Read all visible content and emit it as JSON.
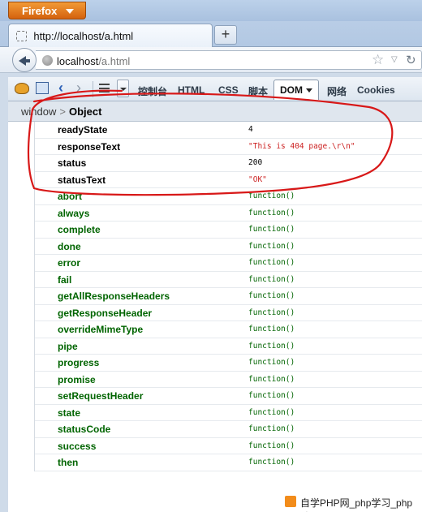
{
  "browser": {
    "firefox_menu_label": "Firefox",
    "ghost_tab_text": "...",
    "tab_title": "http://localhost/a.html",
    "new_tab_label": "+",
    "url_host": "localhost",
    "url_path": "/a.html"
  },
  "firebug": {
    "tabs": [
      "控制台",
      "HTML",
      "CSS",
      "脚本",
      "DOM",
      "网络",
      "Cookies"
    ],
    "active_tab": "DOM",
    "breadcrumb": {
      "parent": "window",
      "separator": ">",
      "current": "Object"
    }
  },
  "dom": {
    "properties": [
      {
        "name": "readyState",
        "value": "4"
      },
      {
        "name": "responseText",
        "value": "\"This is 404 page.\\r\\n\""
      },
      {
        "name": "status",
        "value": "200"
      },
      {
        "name": "statusText",
        "value": "\"OK\""
      }
    ],
    "functions": [
      "abort",
      "always",
      "complete",
      "done",
      "error",
      "fail",
      "getAllResponseHeaders",
      "getResponseHeader",
      "overrideMimeType",
      "pipe",
      "progress",
      "promise",
      "setRequestHeader",
      "state",
      "statusCode",
      "success",
      "then"
    ],
    "function_value": "function()"
  },
  "watermark": "自学PHP网_php学习_php教",
  "colors": {
    "annotation": "#d81818",
    "function_green": "#006400",
    "string_red": "#cc2222"
  }
}
